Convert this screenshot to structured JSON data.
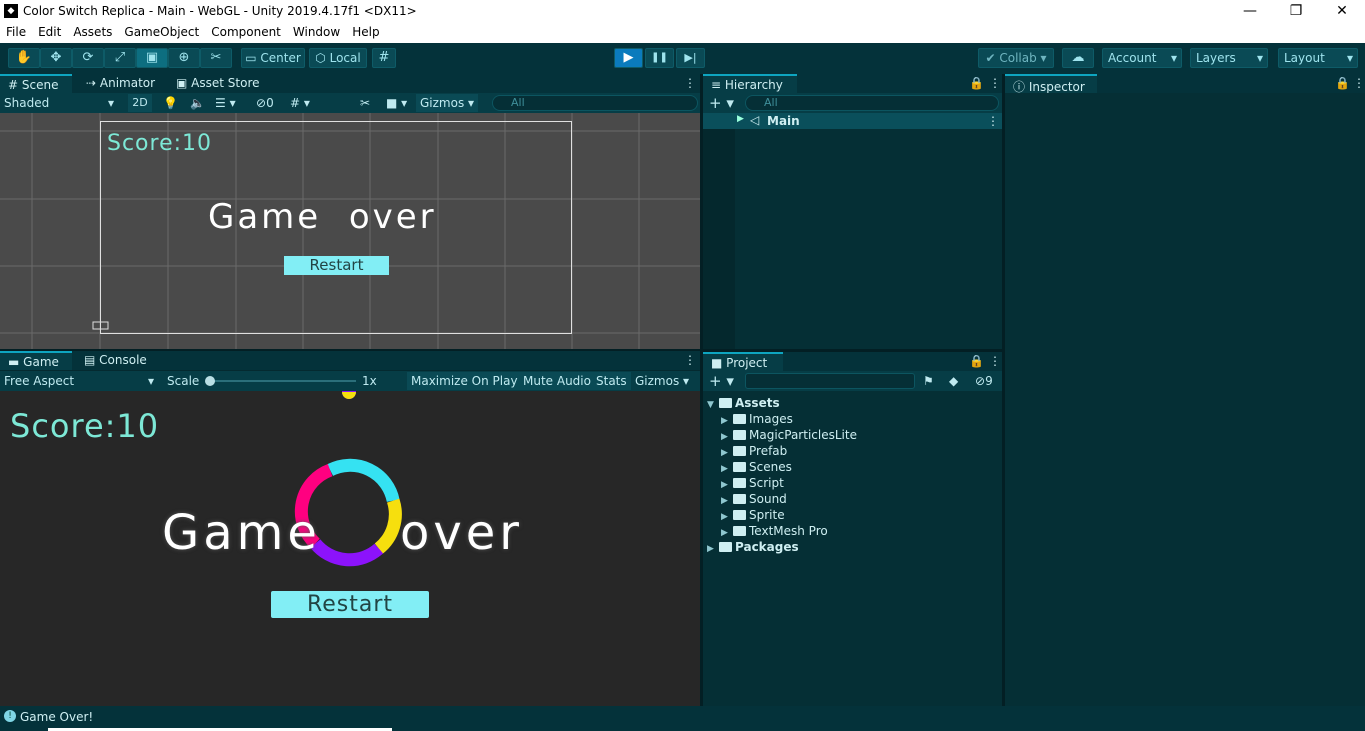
{
  "window": {
    "title": "Color Switch Replica - Main - WebGL - Unity 2019.4.17f1 <DX11>",
    "minimize": "—",
    "maximize": "❐",
    "close": "✕"
  },
  "menu": [
    "File",
    "Edit",
    "Assets",
    "GameObject",
    "Component",
    "Window",
    "Help"
  ],
  "toolbar": {
    "center": "Center",
    "local": "Local",
    "collab": "Collab",
    "account": "Account",
    "layers": "Layers",
    "layout": "Layout",
    "collab_check_icon": "✔",
    "play": "▶",
    "pause": "❚❚",
    "step": "▶|"
  },
  "scene": {
    "tabs": [
      "Scene",
      "Animator",
      "Asset Store"
    ],
    "shading": "Shaded",
    "mode_2d": "2D",
    "hidden_count": "0",
    "gizmos": "Gizmos",
    "search_placeholder": "All",
    "score_text": "Score:10",
    "game_over": "Game  over",
    "restart": "Restart"
  },
  "hierarchy": {
    "tab": "Hierarchy",
    "search_placeholder": "All",
    "root": "Main"
  },
  "inspector": {
    "tab": "Inspector"
  },
  "game": {
    "tabs": [
      "Game",
      "Console"
    ],
    "aspect": "Free Aspect",
    "scale_label": "Scale",
    "scale_value": "1x",
    "maximize": "Maximize On Play",
    "mute": "Mute Audio",
    "stats": "Stats",
    "gizmos": "Gizmos",
    "score_text": "Score:10",
    "game": "Game",
    "over": "over",
    "restart": "Restart",
    "ring_colors": [
      "#35e2f2",
      "#f6df0e",
      "#8c13fb",
      "#ff0080"
    ]
  },
  "project": {
    "tab": "Project",
    "hidden_count": "9",
    "root": "Assets",
    "folders": [
      "Images",
      "MagicParticlesLite",
      "Prefab",
      "Scenes",
      "Script",
      "Sound",
      "Sprite",
      "TextMesh Pro"
    ],
    "packages": "Packages"
  },
  "status": {
    "message": "Game Over!"
  }
}
